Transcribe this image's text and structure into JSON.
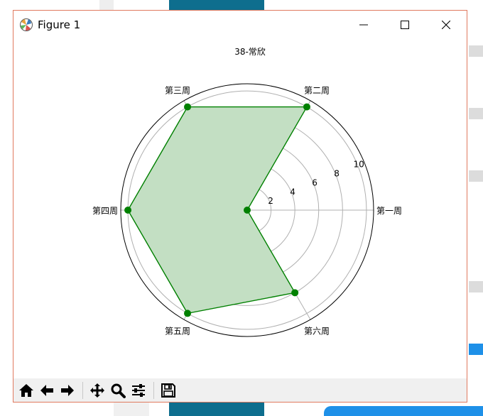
{
  "window": {
    "title": "Figure 1"
  },
  "toolbar": {
    "icons": [
      "home-icon",
      "back-arrow-icon",
      "forward-arrow-icon",
      "pan-icon",
      "zoom-icon",
      "configure-subplots-icon",
      "save-icon"
    ]
  },
  "chart_data": {
    "type": "radar",
    "title": "38-常欣",
    "categories": [
      "第一周",
      "第二周",
      "第三周",
      "第四周",
      "第五周",
      "第六周"
    ],
    "series": [
      {
        "values": [
          0,
          10,
          10,
          10,
          10,
          8
        ],
        "color": "#008000",
        "fill": "#c3dfc3"
      }
    ],
    "radial_ticks": [
      2,
      4,
      6,
      8,
      10
    ],
    "rlim": [
      0,
      10.6
    ],
    "grid": true
  }
}
